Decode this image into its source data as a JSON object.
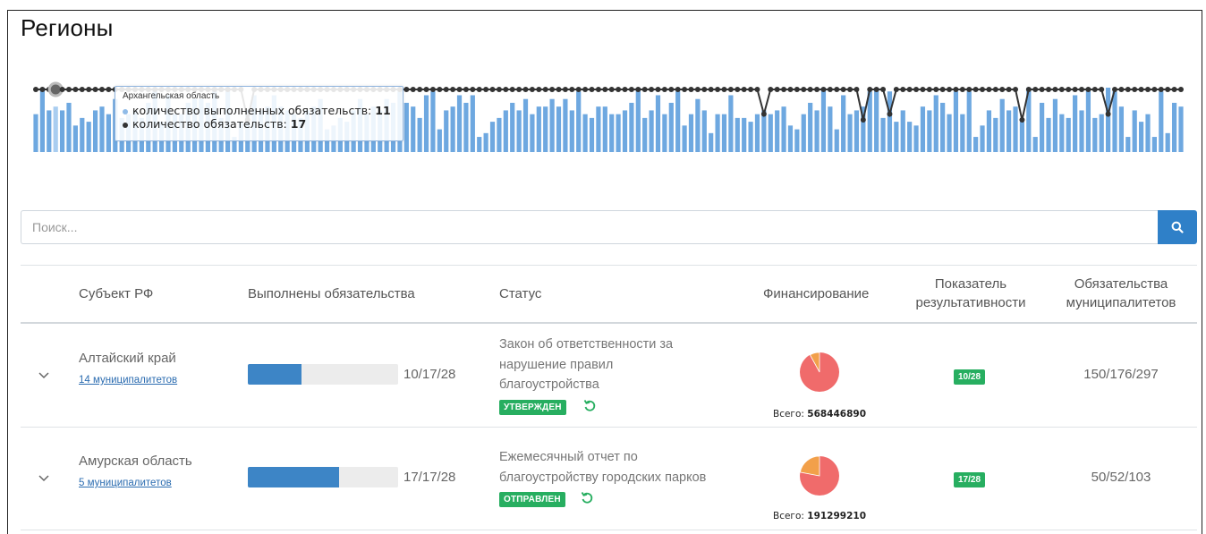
{
  "page": {
    "title": "Регионы"
  },
  "tooltip": {
    "region": "Архангельская область",
    "row1_label": "количество выполненных обязательств:",
    "row1_value": "11",
    "row2_label": "количество обязательств:",
    "row2_value": "17"
  },
  "colors": {
    "bar": "#6ea8e0",
    "bar_hover": "#a9cdf0",
    "line": "#333333",
    "accent": "#2f80c8",
    "badge": "#27ae60",
    "pie_red": "#f06b6b",
    "pie_orange": "#f2a04a"
  },
  "chart_data": {
    "type": "bar+line",
    "series": [
      {
        "name": "количество выполненных обязательств",
        "values": [
          10,
          17,
          11,
          12,
          11,
          13,
          7,
          9,
          8,
          11,
          12,
          10,
          14,
          9,
          10,
          11,
          9,
          13,
          17,
          8,
          15,
          10,
          10,
          13,
          14,
          14,
          13,
          17,
          9,
          17,
          4,
          8,
          11,
          15,
          11,
          12,
          15,
          12,
          11,
          10,
          9,
          11,
          12,
          14,
          6,
          7,
          9,
          8,
          11,
          14,
          10,
          12,
          11,
          14,
          13,
          17,
          13,
          12,
          9,
          15,
          16,
          6,
          11,
          12,
          15,
          13,
          15,
          4,
          5,
          8,
          9,
          11,
          13,
          11,
          14,
          10,
          12,
          12,
          14,
          12,
          14,
          11,
          16,
          10,
          9,
          12,
          12,
          10,
          10,
          11,
          13,
          17,
          9,
          11,
          15,
          10,
          13,
          16,
          7,
          10,
          14,
          11,
          5,
          10,
          10,
          15,
          9,
          9,
          8,
          10,
          11,
          10,
          11,
          12,
          7,
          6,
          10,
          13,
          11,
          17,
          12,
          6,
          15,
          10,
          11,
          12,
          16,
          17,
          9,
          16,
          8,
          11,
          8,
          7,
          12,
          11,
          15,
          13,
          10,
          16,
          10,
          16,
          4,
          7,
          11,
          9,
          14,
          11,
          12,
          8,
          17,
          4,
          13,
          9,
          14,
          10,
          9,
          15,
          11,
          17,
          9,
          10,
          17,
          16,
          12,
          4,
          11,
          8,
          10,
          4,
          16,
          5,
          13,
          12
        ]
      },
      {
        "name": "количество обязательств",
        "values": [
          17,
          17,
          17,
          17,
          17,
          17,
          17,
          17,
          17,
          17,
          17,
          17,
          17,
          17,
          17,
          17,
          17,
          17,
          17,
          17,
          17,
          17,
          17,
          17,
          17,
          17,
          17,
          17,
          17,
          17,
          17,
          17,
          17,
          17,
          17,
          17,
          17,
          17,
          17,
          17,
          17,
          17,
          17,
          17,
          17,
          17,
          17,
          17,
          17,
          17,
          17,
          17,
          17,
          17,
          17,
          17,
          17,
          17,
          17,
          17,
          17,
          17,
          17,
          17,
          17,
          17,
          17,
          17,
          17,
          17,
          17,
          17,
          17,
          17,
          17,
          17,
          17,
          17,
          17,
          17,
          17,
          17,
          17,
          17,
          17,
          17,
          17,
          17,
          17,
          17,
          17,
          17,
          17,
          17,
          17,
          17,
          17,
          17,
          17,
          17,
          17,
          17,
          17,
          17,
          17,
          17,
          17,
          17,
          17,
          17,
          17,
          17,
          17,
          17,
          17,
          17,
          17,
          17,
          17,
          17,
          17,
          17,
          17,
          17,
          17,
          17,
          17,
          17,
          17,
          17,
          17,
          17,
          17,
          17,
          17,
          17,
          17,
          17,
          17,
          17,
          17,
          17,
          17,
          17,
          17,
          17,
          17,
          17,
          17,
          17,
          17,
          17,
          17,
          17,
          17,
          17,
          17,
          17,
          17,
          17,
          17,
          17,
          17,
          17,
          17,
          17,
          17,
          17,
          17,
          17,
          17,
          17,
          17,
          17
        ]
      }
    ],
    "line_drops": [
      {
        "index": 32,
        "value": 3
      },
      {
        "index": 110,
        "value": 6
      },
      {
        "index": 125,
        "value": 3
      },
      {
        "index": 129,
        "value": 6
      },
      {
        "index": 149,
        "value": 3
      },
      {
        "index": 162,
        "value": 6
      }
    ],
    "highlighted_index": 3,
    "grid": false
  },
  "search": {
    "placeholder": "Поиск..."
  },
  "table": {
    "headers": {
      "subject": "Субъект РФ",
      "done": "Выполнены обязательства",
      "status": "Статус",
      "financing": "Финансирование",
      "score_line1": "Показатель",
      "score_line2": "результативности",
      "muni_line1": "Обязательства",
      "muni_line2": "муниципалитетов"
    },
    "rows": [
      {
        "region": "Алтайский край",
        "municipalities": "14 муниципалитетов",
        "progress_text": "10/17/28",
        "progress_fraction": 0.357,
        "status_line1": "Закон об ответственности за",
        "status_line2": "нарушение правил",
        "status_line3": "благоустройства",
        "status_badge": "УТВЕРЖДЕН",
        "pie_orange_fraction": 0.08,
        "total_label": "Всего:",
        "total_value": "568446890",
        "score": "10/28",
        "obligations": "150/176/297"
      },
      {
        "region": "Амурская область",
        "municipalities": "5 муниципалитетов",
        "progress_text": "17/17/28",
        "progress_fraction": 0.607,
        "status_line1": "Ежемесячный отчет по",
        "status_line2": "благоустройству городских парков",
        "status_badge": "ОТПРАВЛЕН",
        "pie_orange_fraction": 0.22,
        "total_label": "Всего:",
        "total_value": "191299210",
        "score": "17/28",
        "obligations": "50/52/103"
      }
    ]
  }
}
